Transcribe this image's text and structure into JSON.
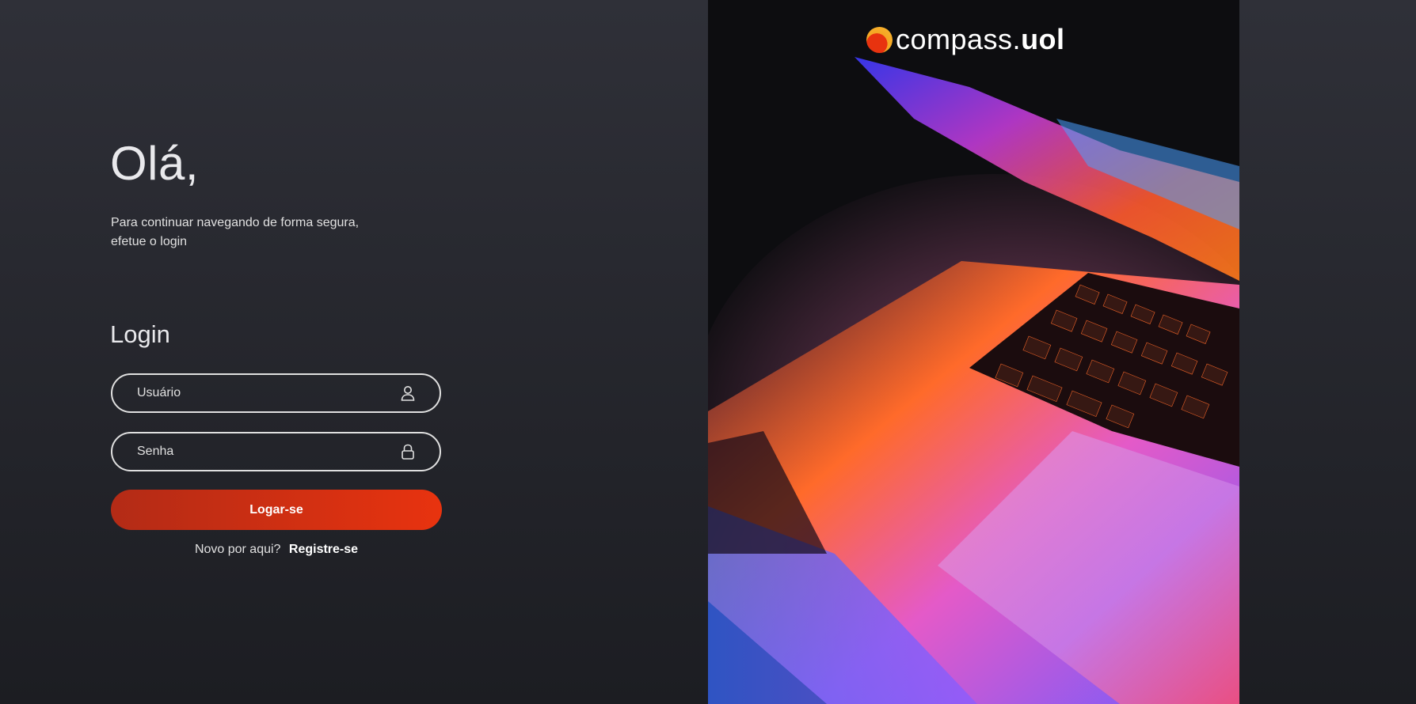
{
  "greeting": "Olá,",
  "subtitle_line1": "Para continuar navegando de forma segura,",
  "subtitle_line2": "efetue o login",
  "login_title": "Login",
  "fields": {
    "username_placeholder": "Usuário",
    "username_icon": "user-icon",
    "password_placeholder": "Senha",
    "password_icon": "lock-icon"
  },
  "submit_label": "Logar-se",
  "register": {
    "prompt": "Novo por aqui?",
    "link_label": "Registre-se"
  },
  "brand": {
    "name_part1": "compass.",
    "name_part2": "uol",
    "logo_icon": "compass-uol-logo-icon"
  },
  "hero_image": "laptop-keyboard-photo",
  "colors": {
    "accent": "#e8330f",
    "background_top": "#2f3038",
    "background_bottom": "#1c1d22",
    "text": "#e0e0e0"
  }
}
